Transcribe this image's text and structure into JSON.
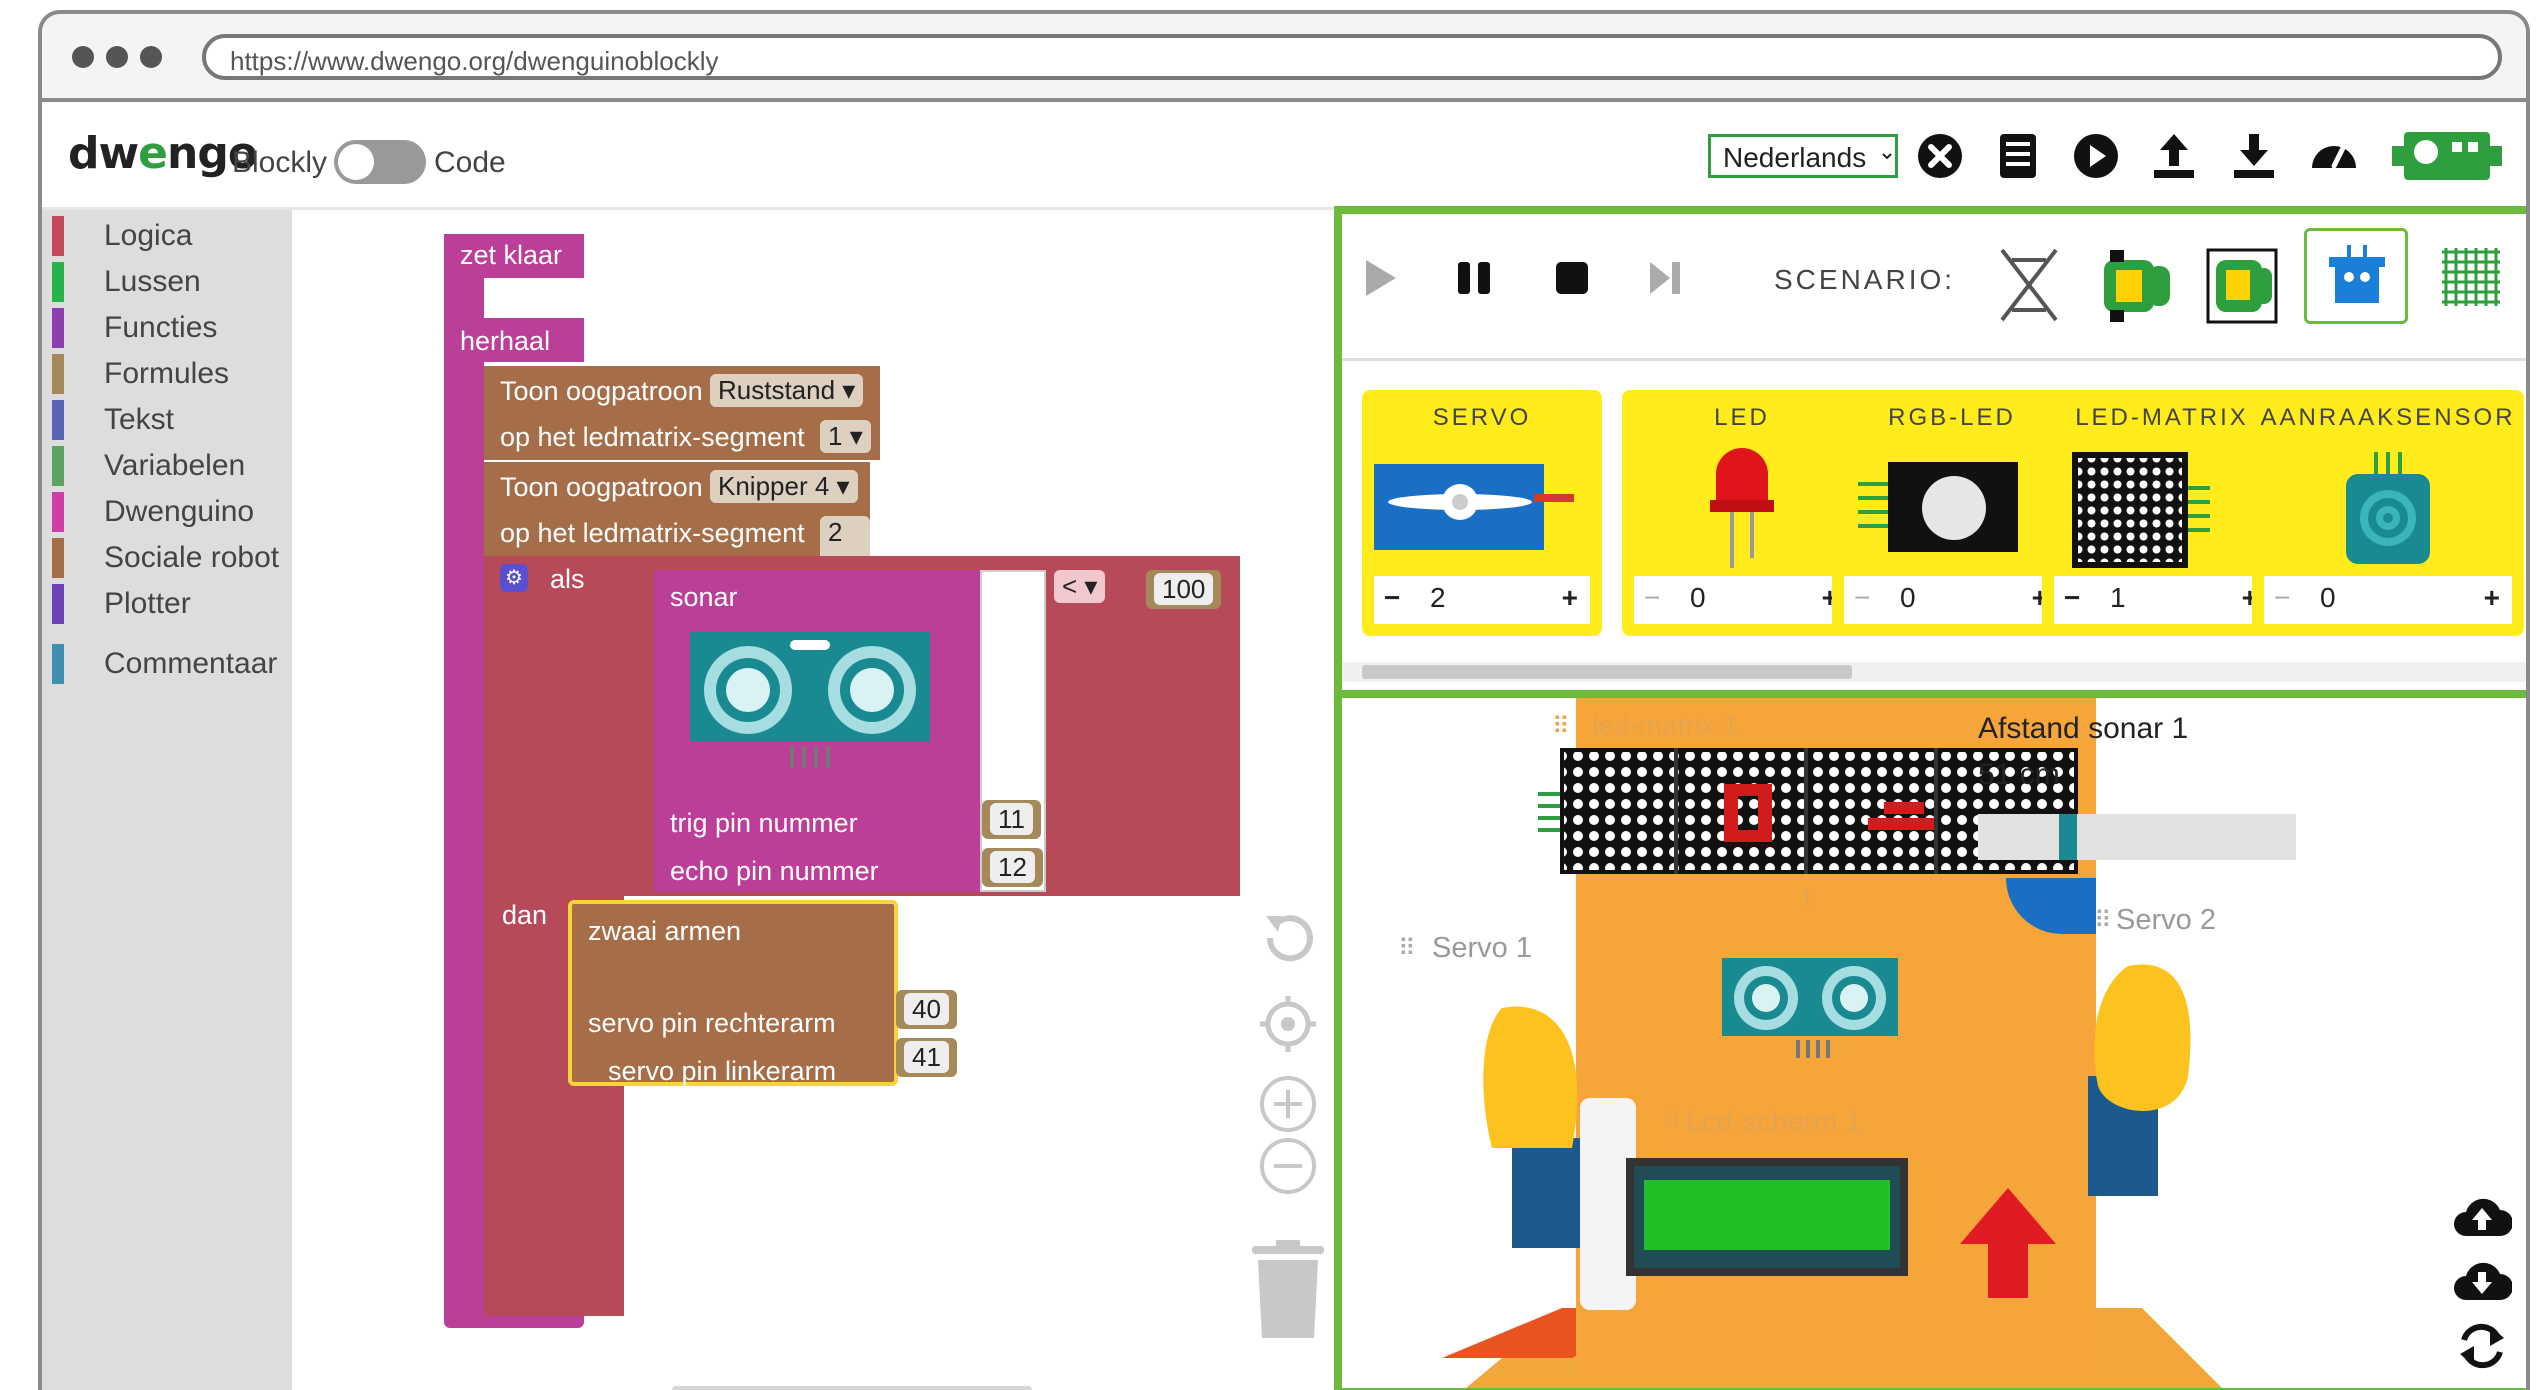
{
  "browser": {
    "url": "https://www.dwengo.org/dwenguinoblockly"
  },
  "header": {
    "logo_text": "dwengo",
    "toggle_left": "Blockly",
    "toggle_right": "Code",
    "language": "Nederlands",
    "icons": [
      "close-circle-icon",
      "save-file-icon",
      "play-icon",
      "upload-icon",
      "download-icon",
      "speedometer-icon",
      "dwenguino-board-icon"
    ]
  },
  "toolbox": {
    "categories": [
      {
        "label": "Logica",
        "color": "#c34a5b"
      },
      {
        "label": "Lussen",
        "color": "#28b34a"
      },
      {
        "label": "Functies",
        "color": "#8d3fb0"
      },
      {
        "label": "Formules",
        "color": "#a48a5a"
      },
      {
        "label": "Tekst",
        "color": "#5a63b5"
      },
      {
        "label": "Variabelen",
        "color": "#5aa360"
      },
      {
        "label": "Dwenguino",
        "color": "#cf3ea7"
      },
      {
        "label": "Sociale robot",
        "color": "#a56e49"
      },
      {
        "label": "Plotter",
        "color": "#6b42b8"
      },
      {
        "label": "Commentaar",
        "color": "#3e8fb0"
      }
    ]
  },
  "blocks": {
    "setup_label": "zet klaar",
    "loop_label": "herhaal",
    "eye1_label": "Toon oogpatroon",
    "eye1_value": "Ruststand",
    "seg1_label": "op het ledmatrix-segment",
    "seg1_value": "1",
    "eye2_label": "Toon oogpatroon",
    "eye2_value": "Knipper 4",
    "seg2_label": "op het ledmatrix-segment",
    "seg2_value": "2",
    "if_label": "als",
    "sonar_label": "sonar",
    "compare_op": "<",
    "compare_value": "100",
    "trig_label": "trig pin nummer",
    "trig_value": "11",
    "echo_label": "echo pin nummer",
    "echo_value": "12",
    "then_label": "dan",
    "wave_label": "zwaai armen",
    "servo_right_label": "servo pin rechterarm",
    "servo_right_value": "40",
    "servo_left_label": "servo pin linkerarm",
    "servo_left_value": "41"
  },
  "simulator": {
    "scenario_label": "SCENARIO:",
    "components": [
      {
        "title": "SERVO",
        "count": "2"
      },
      {
        "title": "LED",
        "count": "0"
      },
      {
        "title": "RGB-LED",
        "count": "0"
      },
      {
        "title": "LED-MATRIX",
        "count": "1"
      },
      {
        "title": "AANRAAKSENSOR",
        "count": "0"
      }
    ],
    "robot": {
      "ledmatrix_label": "led-matrix 1",
      "ledmatrix_index": "1",
      "servo1_label": "Servo 1",
      "servo2_label": "Servo 2",
      "lcd_label": "Lcd-scherm 1",
      "sonar_title": "Afstand sonar 1",
      "sonar_value": "51 cm",
      "sonar_slider_fraction": 0.27
    }
  }
}
